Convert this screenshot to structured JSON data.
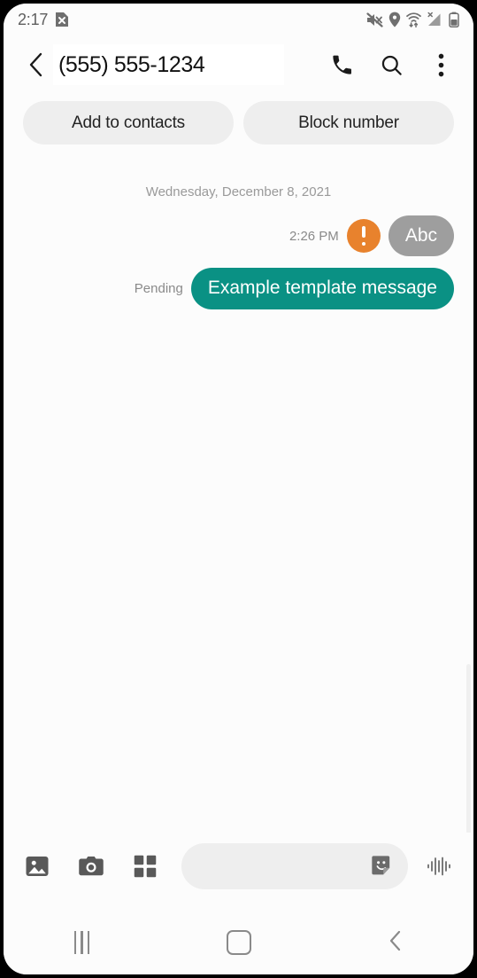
{
  "status_bar": {
    "time": "2:17",
    "left_icons": [
      {
        "name": "app-notification-icon",
        "glyph": "file-x"
      }
    ],
    "right_icons": [
      {
        "name": "volume-mute-icon"
      },
      {
        "name": "location-pin-icon"
      },
      {
        "name": "wifi-data-transfer-icon"
      },
      {
        "name": "cellular-signal-no-service-icon"
      },
      {
        "name": "battery-icon"
      }
    ]
  },
  "app_bar": {
    "back_label": "Back",
    "contact_name": "(555) 555-1234",
    "actions": [
      {
        "name": "call-button",
        "label": "Call"
      },
      {
        "name": "search-button",
        "label": "Search"
      },
      {
        "name": "overflow-menu-button",
        "label": "More options"
      }
    ]
  },
  "quick_actions": {
    "add_to_contacts": "Add to contacts",
    "block_number": "Block number"
  },
  "conversation": {
    "date_separator": "Wednesday, December 8, 2021",
    "messages": [
      {
        "id": "msg-1",
        "meta": "2:26 PM",
        "has_warning": true,
        "warning_label": "Not delivered",
        "text": "Abc",
        "bubble_style": "gray",
        "side": "outgoing"
      },
      {
        "id": "msg-2",
        "meta": "Pending",
        "has_warning": false,
        "warning_label": "",
        "text": "Example template message",
        "bubble_style": "teal",
        "side": "outgoing"
      }
    ]
  },
  "composer": {
    "gallery_label": "Gallery",
    "camera_label": "Camera",
    "apps_label": "Apps",
    "input_value": "",
    "input_placeholder": "",
    "sticker_label": "Stickers",
    "voice_label": "Voice recording"
  },
  "nav_bar": {
    "recents_label": "Recents",
    "home_label": "Home",
    "back_label": "Back"
  },
  "colors": {
    "accent_teal": "#0a9184",
    "warning_orange": "#e8822d",
    "bubble_gray": "#9e9e9e",
    "chip_gray": "#eeeeee",
    "screen_bg": "#fcfcfc"
  }
}
